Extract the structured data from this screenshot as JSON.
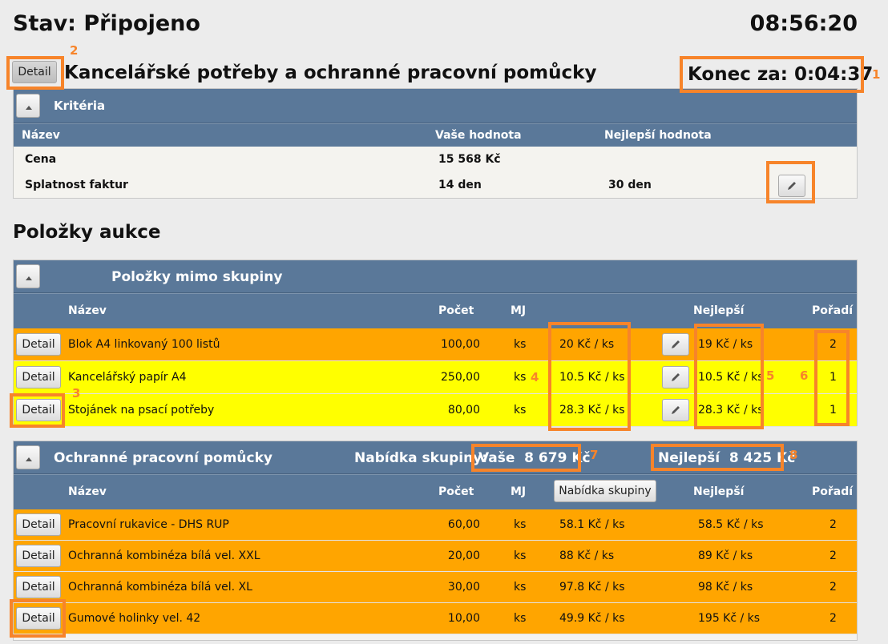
{
  "status": "Stav: Připojeno",
  "clock": "08:56:20",
  "auction_title": "Kancelářské potřeby a ochranné pracovní pomůcky",
  "ending": "Konec za: 0:04:37",
  "detail_label": "Detail",
  "callouts": [
    "1",
    "2",
    "3",
    "4",
    "5",
    "6",
    "7",
    "8"
  ],
  "criteria": {
    "title": "Kritéria",
    "headers": {
      "name": "Název",
      "yours": "Vaše hodnota",
      "best": "Nejlepší hodnota"
    },
    "rows": [
      {
        "name": "Cena",
        "yours": "15 568 Kč",
        "best": ""
      },
      {
        "name": "Splatnost faktur",
        "yours": "14 den",
        "best": "30 den"
      }
    ]
  },
  "items_heading": "Položky aukce",
  "headers": {
    "name": "Název",
    "count": "Počet",
    "unit": "MJ",
    "best": "Nejlepší",
    "rank": "Pořadí"
  },
  "group1": {
    "title": "Položky mimo skupiny",
    "rows": [
      {
        "name": "Blok A4 linkovaný 100 listů",
        "count": "100,00",
        "unit": "ks",
        "bid": "20 Kč / ks",
        "best": "19 Kč / ks",
        "rank": "2",
        "color": "#ffa500"
      },
      {
        "name": "Kancelářský papír A4",
        "count": "250,00",
        "unit": "ks",
        "bid": "10.5 Kč / ks",
        "best": "10.5 Kč / ks",
        "rank": "1",
        "color": "#ffff00"
      },
      {
        "name": "Stojánek na psací potřeby",
        "count": "80,00",
        "unit": "ks",
        "bid": "28.3 Kč / ks",
        "best": "28.3 Kč / ks",
        "rank": "1",
        "color": "#ffff00"
      }
    ]
  },
  "group2": {
    "title": "Ochranné pracovní pomůcky",
    "offer_label": "Nabídka skupiny:",
    "yours": "Vaše  8 679 Kč",
    "best": "Nejlepší  8 425 Kč",
    "group_offer_button": "Nabídka skupiny",
    "rows": [
      {
        "name": "Pracovní rukavice - DHS RUP",
        "count": "60,00",
        "unit": "ks",
        "bid": "58.1 Kč / ks",
        "best": "58.5 Kč / ks",
        "rank": "2"
      },
      {
        "name": "Ochranná kombinéza bílá vel. XXL",
        "count": "20,00",
        "unit": "ks",
        "bid": "88 Kč / ks",
        "best": "89 Kč / ks",
        "rank": "2"
      },
      {
        "name": "Ochranná kombinéza bílá vel. XL",
        "count": "30,00",
        "unit": "ks",
        "bid": "97.8 Kč / ks",
        "best": "98 Kč / ks",
        "rank": "2"
      },
      {
        "name": "Gumové holinky vel. 42",
        "count": "10,00",
        "unit": "ks",
        "bid": "49.9 Kč / ks",
        "best": "195 Kč / ks",
        "rank": "2"
      }
    ]
  }
}
